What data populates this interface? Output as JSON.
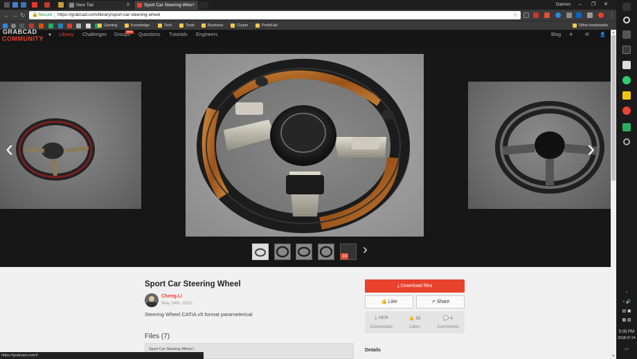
{
  "browser": {
    "user": "Damon",
    "tabs": [
      {
        "title": "New Tab",
        "color": "#888888"
      },
      {
        "title": "Sport Car Steering Whe",
        "color": "#e8412c"
      }
    ],
    "address": {
      "secure_label": "Secure",
      "url": "https://grabcad.com/library/sport-car-steering-wheel"
    },
    "bookmarks": [
      "Gaming",
      "Knowledge",
      "Tech",
      "Tools",
      "Business",
      "Crypto",
      "ProtoFab"
    ],
    "other_bookmarks": "Other bookmarks",
    "status_url": "https://grabcad.com/#"
  },
  "site": {
    "logo_top": "GRABCAD",
    "logo_bottom": "COMMUNITY",
    "nav": [
      "Library",
      "Challenges",
      "Groups",
      "Questions",
      "Tutorials",
      "Engineers"
    ],
    "groups_badge": "NEW",
    "blog": "Blog"
  },
  "gallery": {
    "thumb_badge": "30",
    "selected_thumb": 0
  },
  "model": {
    "title": "Sport Car Steering Wheel",
    "author": "Cheng.Li",
    "date": "May 24th, 2012",
    "description": "Steering Wheel CATIA v5 format parameterical",
    "files_heading": "Files (7)",
    "file_path": "Sport Car Steering Wheel /",
    "download_label": "Download files",
    "like_label": "Like",
    "share_label": "Share",
    "stats": [
      {
        "value": "1604",
        "label": "Downloads"
      },
      {
        "value": "56",
        "label": "Likes"
      },
      {
        "value": "4",
        "label": "Comments"
      }
    ],
    "details_heading": "Details"
  },
  "taskbar": {
    "time": "5:05 PM",
    "date": "2018-07-24"
  },
  "colors": {
    "accent": "#e8412c",
    "wood": "#b5651d",
    "leather": "#1e1e1e"
  }
}
